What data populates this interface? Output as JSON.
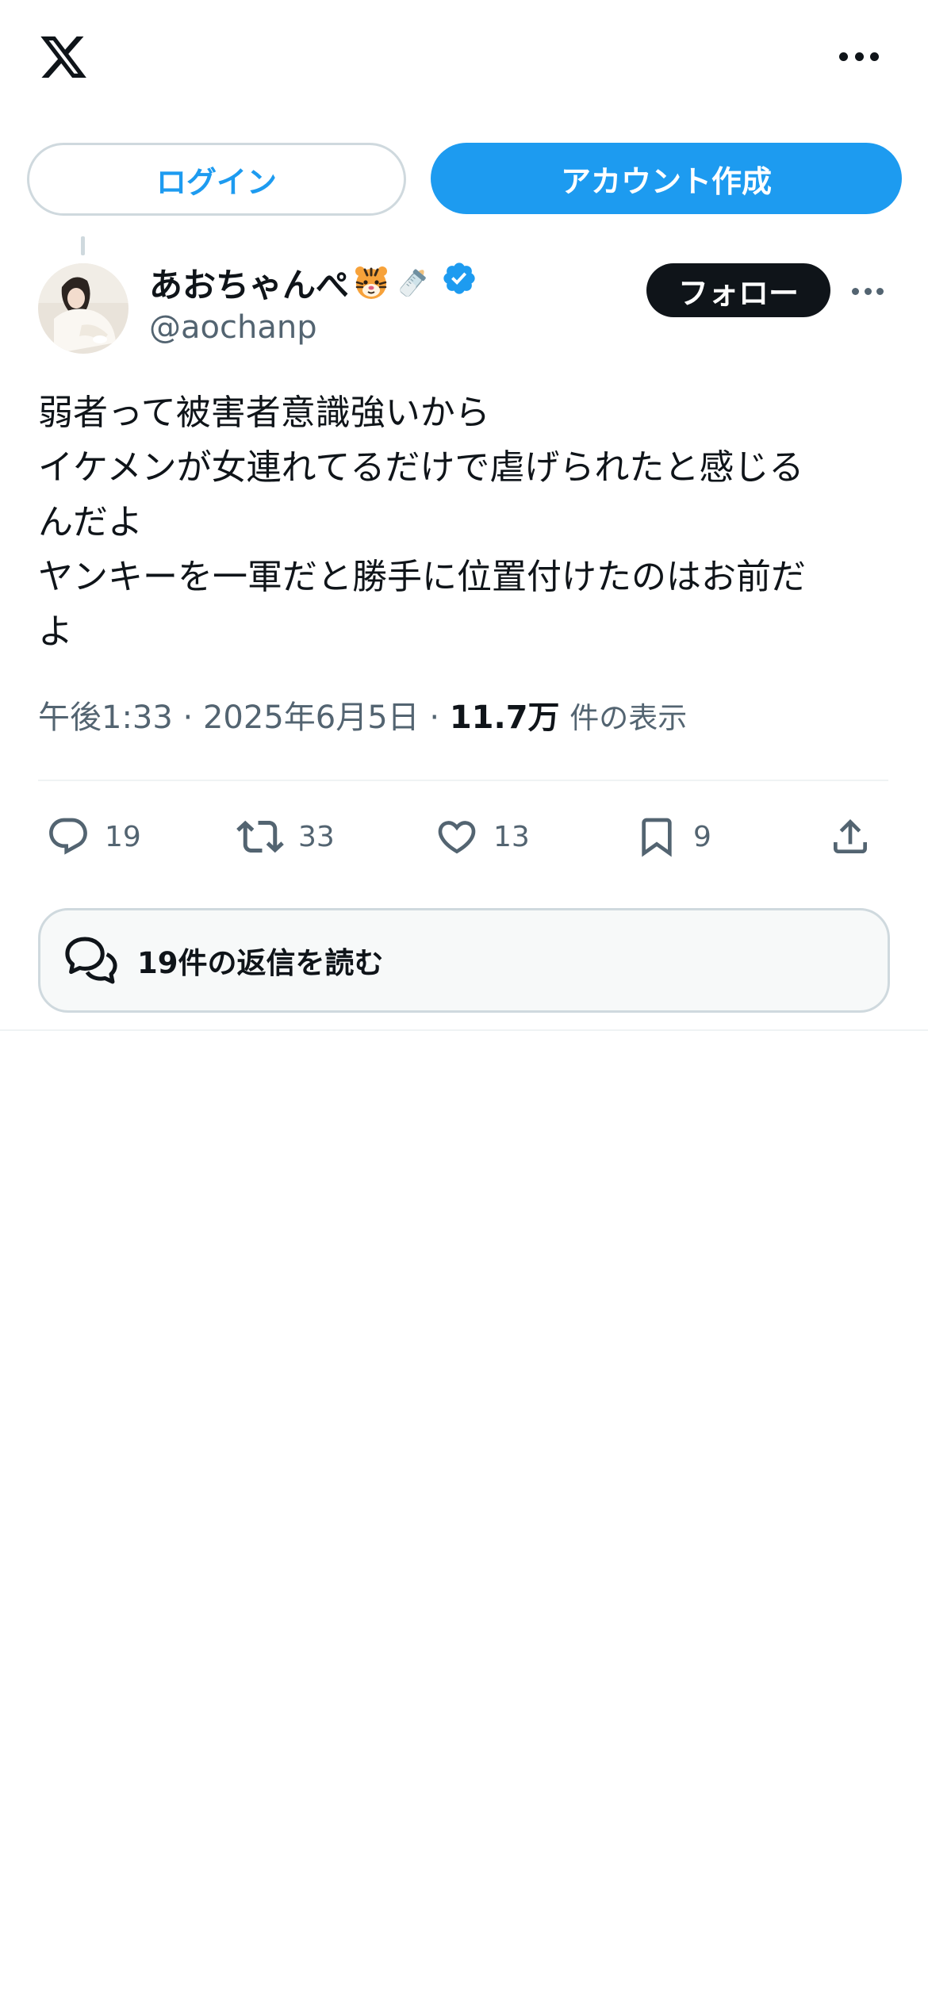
{
  "topbar": {
    "logo": "x-logo-icon",
    "more": "more-horizontal-icon"
  },
  "auth": {
    "login_label": "ログイン",
    "signup_label": "アカウント作成"
  },
  "tweet": {
    "author": {
      "display_name": "あおちゃんぺ",
      "emojis": [
        "tiger-face-icon",
        "baby-bottle-icon"
      ],
      "verified": true,
      "handle": "@aochanp"
    },
    "follow_label": "フォロー",
    "text_lines": [
      "弱者って被害者意識強いから",
      "イケメンが女連れてるだけで虐げられたと感じる",
      "んだよ",
      "ヤンキーを一軍だと勝手に位置付けたのはお前だ",
      "よ"
    ],
    "time": "午後1:33",
    "date": "2025年6月5日",
    "separator": "·",
    "views_count": "11.7万",
    "views_label": "件の表示",
    "actions": {
      "replies": "19",
      "reposts": "33",
      "likes": "13",
      "bookmarks": "9"
    },
    "read_replies_label": "19件の返信を読む"
  },
  "colors": {
    "accent": "#1d9bf0",
    "text": "#0f1419",
    "secondary": "#536471",
    "border": "#cfd9de",
    "follow_bg": "#0f1419"
  }
}
